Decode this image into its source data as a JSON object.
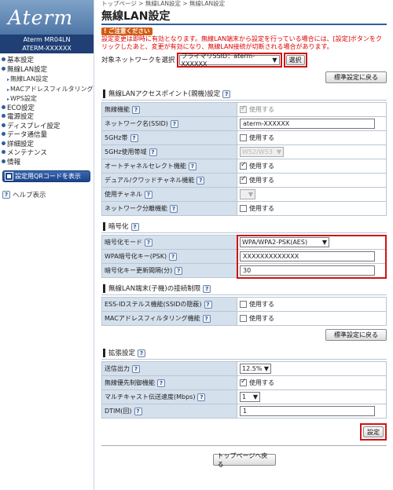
{
  "brand": {
    "logo": "Aterm",
    "model": "Aterm MR04LN",
    "ssid": "ATERM-XXXXXX"
  },
  "nav": {
    "items": [
      {
        "label": "基本設定",
        "type": "top"
      },
      {
        "label": "無線LAN設定",
        "type": "top"
      },
      {
        "label": "無線LAN設定",
        "type": "sub"
      },
      {
        "label": "MACアドレスフィルタリング",
        "type": "sub"
      },
      {
        "label": "WPS設定",
        "type": "sub"
      },
      {
        "label": "ECO設定",
        "type": "top"
      },
      {
        "label": "電源設定",
        "type": "top"
      },
      {
        "label": "ディスプレイ設定",
        "type": "top"
      },
      {
        "label": "データ通信量",
        "type": "top"
      },
      {
        "label": "詳細設定",
        "type": "top"
      },
      {
        "label": "メンテナンス",
        "type": "top"
      },
      {
        "label": "情報",
        "type": "top"
      }
    ],
    "qr_button": "設定用QRコードを表示",
    "help": "ヘルプ表示"
  },
  "breadcrumb": "トップページ > 無線LAN設定 > 無線LAN設定",
  "title": "無線LAN設定",
  "caution": {
    "label": "ご注意ください",
    "text": "設定変更は即時に有効となります。無線LAN端末から設定を行っている場合には、[設定]ボタンをクリックしたあと、変更が有効になり、無線LAN接続が切断される場合があります。"
  },
  "target": {
    "label": "対象ネットワークを選択",
    "value": "プライマリSSID：aterm-XXXXXX",
    "select_button": "選択"
  },
  "restore_default": "標準設定に戻る",
  "ap_section": {
    "title": "無線LANアクセスポイント(親機)設定",
    "rows": [
      {
        "label": "無線機能",
        "kind": "check",
        "checked": true,
        "disabled": true,
        "text": "使用する"
      },
      {
        "label": "ネットワーク名(SSID)",
        "kind": "text",
        "value": "aterm-XXXXXX"
      },
      {
        "label": "5GHz帯",
        "kind": "check",
        "checked": false,
        "disabled": false,
        "text": "使用する"
      },
      {
        "label": "5GHz使用帯域",
        "kind": "select",
        "value": "W52/W53",
        "disabled": true
      },
      {
        "label": "オートチャネルセレクト機能",
        "kind": "check",
        "checked": true,
        "disabled": false,
        "text": "使用する"
      },
      {
        "label": "デュアル/クワッドチャネル機能",
        "kind": "check",
        "checked": true,
        "disabled": false,
        "text": "使用する"
      },
      {
        "label": "使用チャネル",
        "kind": "select",
        "value": "",
        "disabled": true
      },
      {
        "label": "ネットワーク分離機能",
        "kind": "check",
        "checked": false,
        "disabled": false,
        "text": "使用する"
      }
    ]
  },
  "enc_section": {
    "title": "暗号化",
    "rows": [
      {
        "label": "暗号化モード",
        "value": "WPA/WPA2-PSK(AES)"
      },
      {
        "label": "WPA暗号化キー(PSK)",
        "value": "XXXXXXXXXXXXX"
      },
      {
        "label": "暗号化キー更新間隔(分)",
        "value": "30"
      }
    ]
  },
  "client_section": {
    "title": "無線LAN端末(子機)の接続制限",
    "rows": [
      {
        "label": "ESS-IDステルス機能(SSIDの隠蔽)",
        "text": "使用する"
      },
      {
        "label": "MACアドレスフィルタリング機能",
        "text": "使用する"
      }
    ]
  },
  "ext_section": {
    "title": "拡張設定",
    "rows": [
      {
        "label": "送信出力",
        "kind": "select",
        "value": "12.5%"
      },
      {
        "label": "無線優先制御機能",
        "kind": "check",
        "checked": true,
        "text": "使用する"
      },
      {
        "label": "マルチキャスト伝送速度(Mbps)",
        "kind": "select",
        "value": "1"
      },
      {
        "label": "DTIM(回)",
        "kind": "text",
        "value": "1"
      }
    ]
  },
  "set_button": "設定",
  "back_top_button": "トップページへ戻る"
}
